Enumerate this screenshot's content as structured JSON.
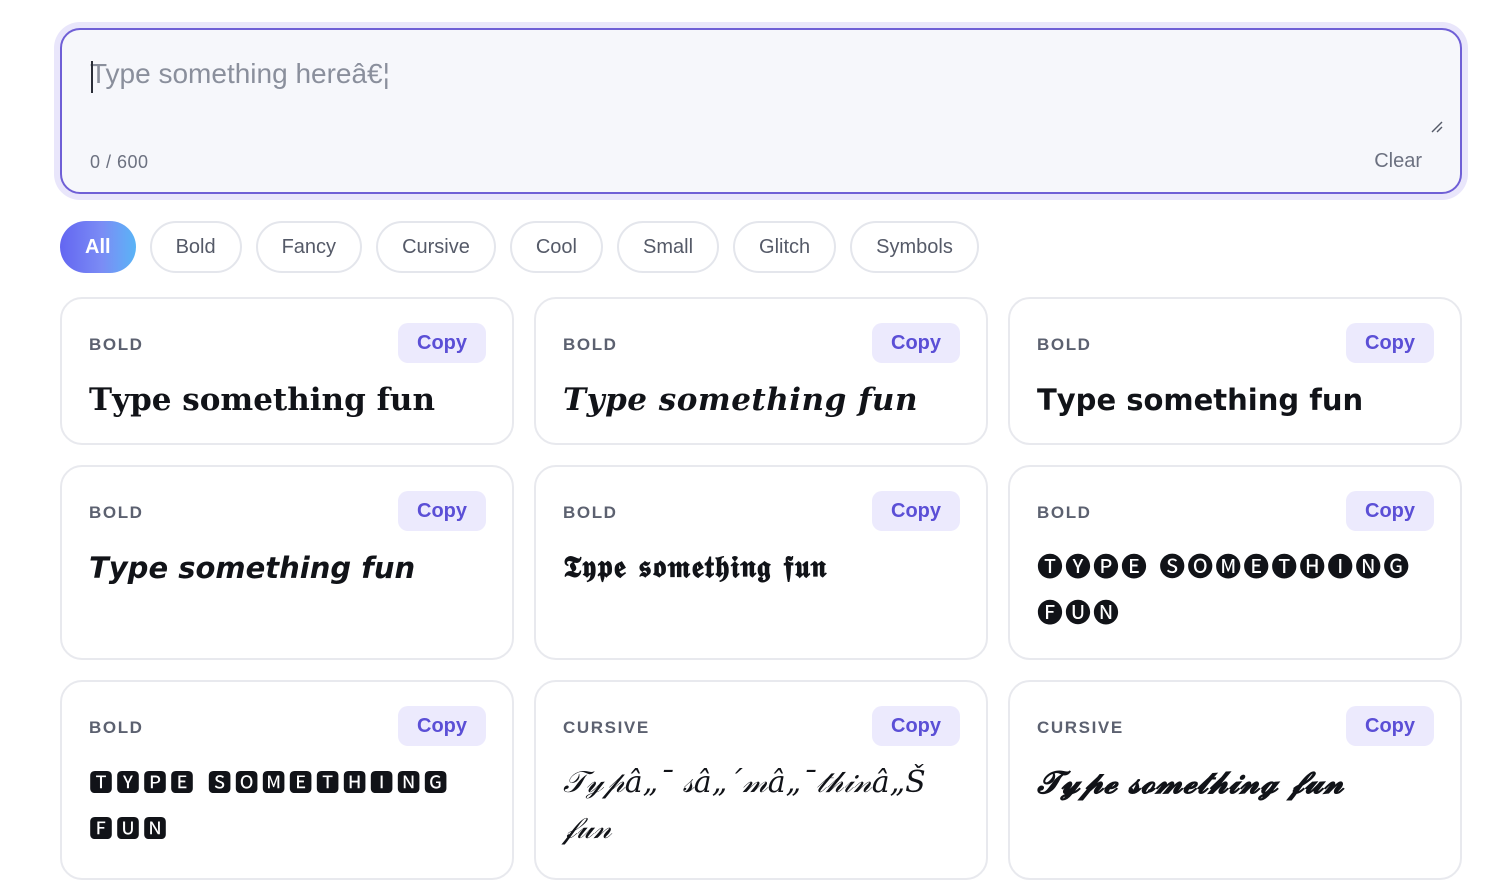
{
  "input": {
    "placeholder": "Type something hereâ€¦",
    "value": "",
    "char_count": "0 / 600",
    "clear_label": "Clear"
  },
  "filters": [
    {
      "label": "All",
      "active": true
    },
    {
      "label": "Bold",
      "active": false
    },
    {
      "label": "Fancy",
      "active": false
    },
    {
      "label": "Cursive",
      "active": false
    },
    {
      "label": "Cool",
      "active": false
    },
    {
      "label": "Small",
      "active": false
    },
    {
      "label": "Glitch",
      "active": false
    },
    {
      "label": "Symbols",
      "active": false
    }
  ],
  "colors": {
    "accent": "#6f5fd6",
    "copy_button_bg": "#eceafd",
    "copy_button_text": "#5b4fd6",
    "chip_gradient_start": "#6366f1",
    "chip_gradient_end": "#5ab4f6"
  },
  "cards": [
    {
      "category": "BOLD",
      "copy_label": "Copy",
      "text": "𝐓𝐲𝐩𝐞 𝐬𝐨𝐦𝐞𝐭𝐡𝐢𝐧𝐠 𝐟𝐮𝐧"
    },
    {
      "category": "BOLD",
      "copy_label": "Copy",
      "text": "𝑻𝒚𝒑𝒆 𝒔𝒐𝒎𝒆𝒕𝒉𝒊𝒏𝒈 𝒇𝒖𝒏"
    },
    {
      "category": "BOLD",
      "copy_label": "Copy",
      "text": "𝗧𝘆𝗽𝗲 𝘀𝗼𝗺𝗲𝘁𝗵𝗶𝗻𝗴 𝗳𝘂𝗻"
    },
    {
      "category": "BOLD",
      "copy_label": "Copy",
      "text": "𝙏𝙮𝙥𝙚 𝙨𝙤𝙢𝙚𝙩𝙝𝙞𝙣𝙜 𝙛𝙪𝙣"
    },
    {
      "category": "BOLD",
      "copy_label": "Copy",
      "text": "𝕿𝖞𝖕𝖊 𝖘𝖔𝖒𝖊𝖙𝖍𝖎𝖓𝖌 𝖋𝖚𝖓"
    },
    {
      "category": "BOLD",
      "copy_label": "Copy",
      "text": "🅣🅨🅟🅔 🅢🅞🅜🅔🅣🅗🅘🅝🅖 🅕🅤🅝"
    },
    {
      "category": "BOLD",
      "copy_label": "Copy",
      "text": "🆃🆈🅿🅴 🆂🅾🅼🅴🆃🅷🅸🅽🅶 🅵🆄🅽"
    },
    {
      "category": "CURSIVE",
      "copy_label": "Copy",
      "text": "𝒯𝓎𝓅â„¯ 𝓈â„´𝓂â„¯𝓉𝒽𝒾𝓃â„Š 𝒻𝓊𝓃"
    },
    {
      "category": "CURSIVE",
      "copy_label": "Copy",
      "text": "𝓣𝔂𝓹𝓮 𝓼𝓸𝓶𝓮𝓽𝓱𝓲𝓷𝓰 𝓯𝓾𝓷"
    }
  ]
}
